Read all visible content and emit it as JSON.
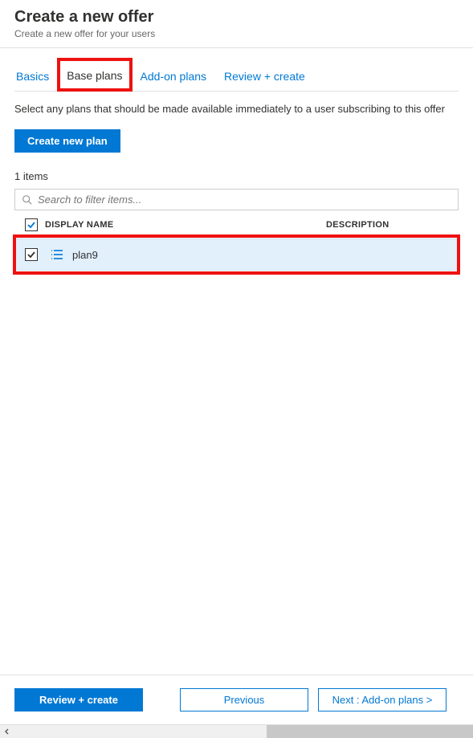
{
  "header": {
    "title": "Create a new offer",
    "subtitle": "Create a new offer for your users"
  },
  "tabs": {
    "basics": "Basics",
    "base_plans": "Base plans",
    "addon_plans": "Add-on plans",
    "review_create": "Review + create"
  },
  "content": {
    "description": "Select any plans that should be made available immediately to a user subscribing to this offer",
    "create_plan_label": "Create new plan",
    "items_count": "1 items",
    "search_placeholder": "Search to filter items...",
    "columns": {
      "display_name": "DISPLAY NAME",
      "description": "DESCRIPTION"
    },
    "rows": [
      {
        "name": "plan9",
        "description": "",
        "checked": true
      }
    ]
  },
  "footer": {
    "review_create": "Review + create",
    "previous": "Previous",
    "next": "Next : Add-on plans >"
  }
}
